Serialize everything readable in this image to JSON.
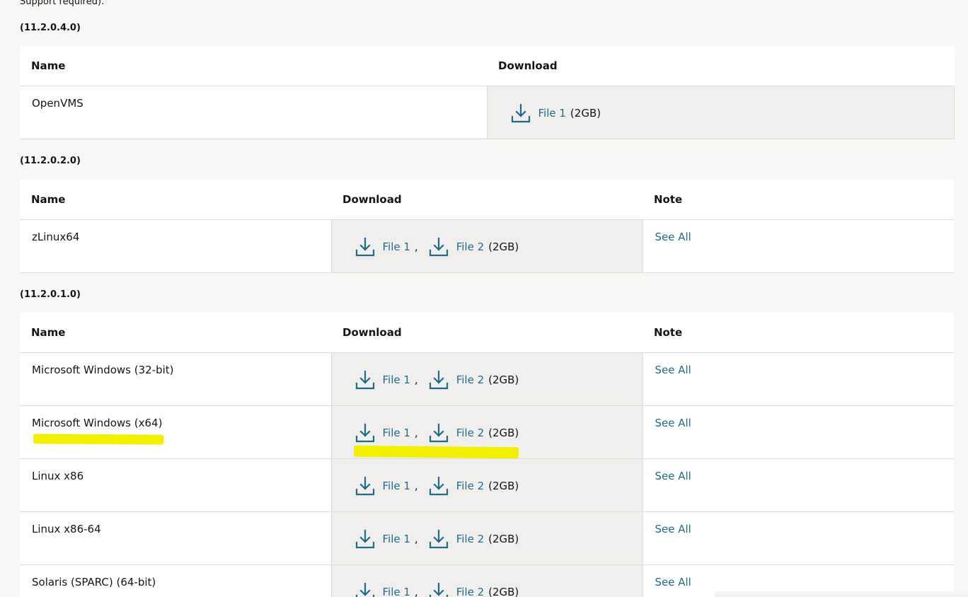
{
  "top_note": "Support required).",
  "section1": {
    "version": "(11.2.0.4.0)",
    "headers": {
      "name": "Name",
      "download": "Download"
    },
    "rows": [
      {
        "name": "OpenVMS",
        "file1": "File 1",
        "size": "(2GB)"
      }
    ]
  },
  "section2": {
    "version": "(11.2.0.2.0)",
    "headers": {
      "name": "Name",
      "download": "Download",
      "note": "Note"
    },
    "rows": [
      {
        "name": "zLinux64",
        "file1": "File 1",
        "comma": ",",
        "file2": "File 2",
        "size": "(2GB)",
        "note": "See All"
      }
    ]
  },
  "section3": {
    "version": "(11.2.0.1.0)",
    "headers": {
      "name": "Name",
      "download": "Download",
      "note": "Note"
    },
    "rows": [
      {
        "name": "Microsoft Windows (32-bit)",
        "file1": "File 1",
        "comma": ",",
        "file2": "File 2",
        "size": "(2GB)",
        "note": "See All"
      },
      {
        "name": "Microsoft Windows (x64)",
        "file1": "File 1",
        "comma": ",",
        "file2": "File 2",
        "size": "(2GB)",
        "note": "See All"
      },
      {
        "name": "Linux x86",
        "file1": "File 1",
        "comma": ",",
        "file2": "File 2",
        "size": "(2GB)",
        "note": "See All"
      },
      {
        "name": "Linux x86-64",
        "file1": "File 1",
        "comma": ",",
        "file2": "File 2",
        "size": "(2GB)",
        "note": "See All"
      },
      {
        "name": "Solaris (SPARC) (64-bit)",
        "file1": "File 1",
        "comma": ",",
        "file2": "File 2",
        "size": "(2GB)",
        "note": "See All"
      }
    ]
  },
  "colors": {
    "link": "#1f6b8c",
    "highlight": "#f2f000",
    "download_cell_bg": "#f0efed"
  }
}
